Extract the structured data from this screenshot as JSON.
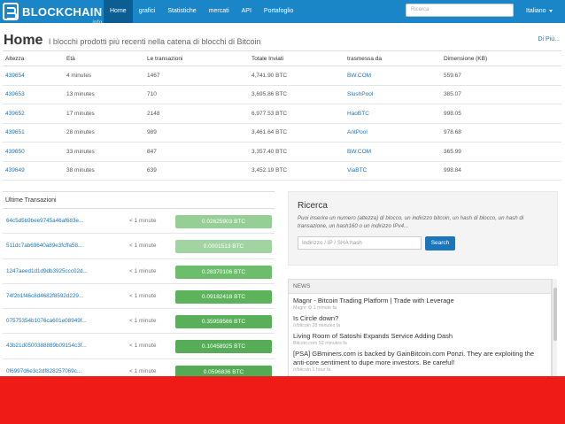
{
  "nav": {
    "logo": "BLOCKCHAIN",
    "logo_sub": "info",
    "items": [
      "Home",
      "grafici",
      "Statistiche",
      "mercati",
      "API",
      "Portafoglio"
    ],
    "active_index": 0,
    "search_placeholder": "Ricerca",
    "language": "Italiano"
  },
  "header": {
    "title": "Home",
    "subtitle": "I blocchi prodotti più recenti nella catena di blocchi di Bitcoin",
    "more_link": "Di Più..."
  },
  "blocks": {
    "columns": [
      "Altezza",
      "Età",
      "Le transazioni",
      "Totale Inviati",
      "trasmessa da",
      "Dimensione (KB)"
    ],
    "rows": [
      [
        "439654",
        "4 minutes",
        "1467",
        "4,741.90 BTC",
        "BW.COM",
        "559.67"
      ],
      [
        "439653",
        "13 minutes",
        "710",
        "3,695.86 BTC",
        "SlushPool",
        "385.07"
      ],
      [
        "439652",
        "17 minutes",
        "2148",
        "6,977.53 BTC",
        "HaoBTC",
        "998.05"
      ],
      [
        "439651",
        "28 minutes",
        "989",
        "3,461.64 BTC",
        "AntPool",
        "978.68"
      ],
      [
        "439650",
        "33 minutes",
        "847",
        "3,357.40 BTC",
        "BW.COM",
        "365.99"
      ],
      [
        "439649",
        "38 minutes",
        "639",
        "3,452.19 BTC",
        "ViaBTC",
        "998.84"
      ]
    ]
  },
  "transactions": {
    "heading": "Ultime Transazioni",
    "rows": [
      {
        "hash": "64c5d5b9bee9745a46af683e...",
        "time": "< 1 minute",
        "amount": "0.02625903 BTC",
        "color": "#96cf96"
      },
      {
        "hash": "511dc7ab69640a89e3fcffa58...",
        "time": "< 1 minute",
        "amount": "0.0001513 BTC",
        "color": "#a2d4a2"
      },
      {
        "hash": "1247aeed1d1d9db3925ccc02d...",
        "time": "< 1 minute",
        "amount": "0.28370106 BTC",
        "color": "#6cbd6c"
      },
      {
        "hash": "74f2b1f46c8d4682f8592d229...",
        "time": "< 1 minute",
        "amount": "0.09182418 BTC",
        "color": "#5cb35c"
      },
      {
        "hash": "07575354b1076ca601e08949f...",
        "time": "< 1 minute",
        "amount": "0.35959566 BTC",
        "color": "#5aaf5a"
      },
      {
        "hash": "43b21d0500388889b09154c3f...",
        "time": "< 1 minute",
        "amount": "0.10458925 BTC",
        "color": "#57ad57"
      },
      {
        "hash": "0f6997d6e3c2df828257069c...",
        "time": "< 1 minute",
        "amount": "0.0596836 BTC",
        "color": "#55ab55"
      }
    ]
  },
  "search": {
    "title": "Ricerca",
    "description": "Puoi inserire un numero (altezza) di blocco, un indirizzo bitcoin, un hash di blocco, un hash di transazione, un hash160 o un indirizzo IPv4...",
    "placeholder": "Indirizzo / IP / SHA hash",
    "button": "Search"
  },
  "news": {
    "heading": "NEWS",
    "items": [
      {
        "title": "Magnr - Bitcoin Trading Platform | Trade with Leverage",
        "meta": "Magnr ⚙ 1 minute fa"
      },
      {
        "title": "Is Circle down?",
        "meta": "/r/bitcoin 28 minutes fa"
      },
      {
        "title": "Living Room of Satoshi Expands Service Adding Dash",
        "meta": "Bitcoin.com 52 minutes fa"
      },
      {
        "title": "[PSA] GBminers.com is backed by GainBitcoin.com Ponzi. They are exploiting the anti-core sentiment to dupe more investors. Be careful!",
        "meta": "/r/bitcoin 1 hour fa"
      }
    ]
  },
  "colors": {
    "navbar": "#1b86c7",
    "nav_active": "#0b5d92",
    "link": "#1b75bb",
    "red_band": "#ee1b17"
  }
}
